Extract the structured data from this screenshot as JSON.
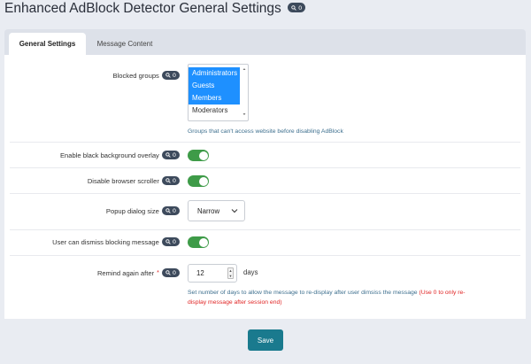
{
  "page_title": "Enhanced AdBlock Detector General Settings",
  "badge_text": "0",
  "tabs": [
    {
      "label": "General Settings",
      "active": true
    },
    {
      "label": "Message Content",
      "active": false
    }
  ],
  "blocked_groups": {
    "label": "Blocked groups",
    "options": [
      {
        "label": "Administrators",
        "selected": true
      },
      {
        "label": "Guests",
        "selected": true
      },
      {
        "label": "Members",
        "selected": true
      },
      {
        "label": "Moderators",
        "selected": false
      }
    ],
    "help": "Groups that can't access website before disabling AdBlock"
  },
  "black_overlay": {
    "label": "Enable black background overlay",
    "enabled": true
  },
  "disable_scroller": {
    "label": "Disable browser scroller",
    "enabled": true
  },
  "popup_size": {
    "label": "Popup dialog size",
    "value": "Narrow"
  },
  "user_dismiss": {
    "label": "User can dismiss blocking message",
    "enabled": true
  },
  "remind_again": {
    "label": "Remind again after",
    "required_mark": "*",
    "value": "12",
    "unit": "days",
    "help_main": "Set number of days to allow the message to re-display after user dimsiss the message",
    "help_red_1": "(Use 0 to only re-",
    "help_red_2": "display message after session end)"
  },
  "save_label": "Save",
  "colors": {
    "accent": "#1a7a8e",
    "toggle_on": "#3e9b48",
    "selected": "#1e90ff",
    "badge": "#3d4a5c",
    "warning": "#e02424"
  }
}
